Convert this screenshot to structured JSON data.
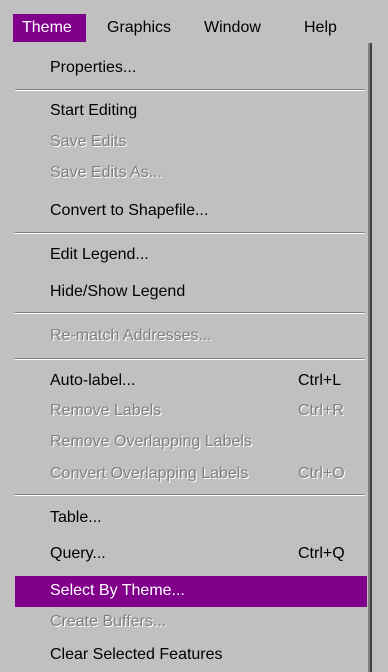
{
  "menubar": {
    "items": [
      {
        "label": "Theme",
        "active": true
      },
      {
        "label": "Graphics"
      },
      {
        "label": "Window"
      },
      {
        "label": "Help"
      }
    ]
  },
  "menu": {
    "items": [
      {
        "label": "Properties...",
        "enabled": true
      },
      {
        "label": "Start Editing",
        "enabled": true
      },
      {
        "label": "Save Edits",
        "enabled": false
      },
      {
        "label": "Save Edits As...",
        "enabled": false
      },
      {
        "label": "Convert to Shapefile...",
        "enabled": true
      },
      {
        "label": "Edit Legend...",
        "enabled": true
      },
      {
        "label": "Hide/Show Legend",
        "enabled": true
      },
      {
        "label": "Re-match Addresses...",
        "enabled": false
      },
      {
        "label": "Auto-label...",
        "shortcut": "Ctrl+L",
        "enabled": true
      },
      {
        "label": "Remove Labels",
        "shortcut": "Ctrl+R",
        "enabled": false
      },
      {
        "label": "Remove Overlapping Labels",
        "enabled": false
      },
      {
        "label": "Convert Overlapping Labels",
        "shortcut": "Ctrl+O",
        "enabled": false
      },
      {
        "label": "Table...",
        "enabled": true
      },
      {
        "label": "Query...",
        "shortcut": "Ctrl+Q",
        "enabled": true
      },
      {
        "label": "Select By Theme...",
        "enabled": true,
        "highlighted": true
      },
      {
        "label": "Create Buffers...",
        "enabled": false
      },
      {
        "label": "Clear Selected Features",
        "enabled": true
      }
    ]
  },
  "colors": {
    "face": "#c0c0c0",
    "highlight": "#80008b",
    "disabled_text": "#808080"
  }
}
